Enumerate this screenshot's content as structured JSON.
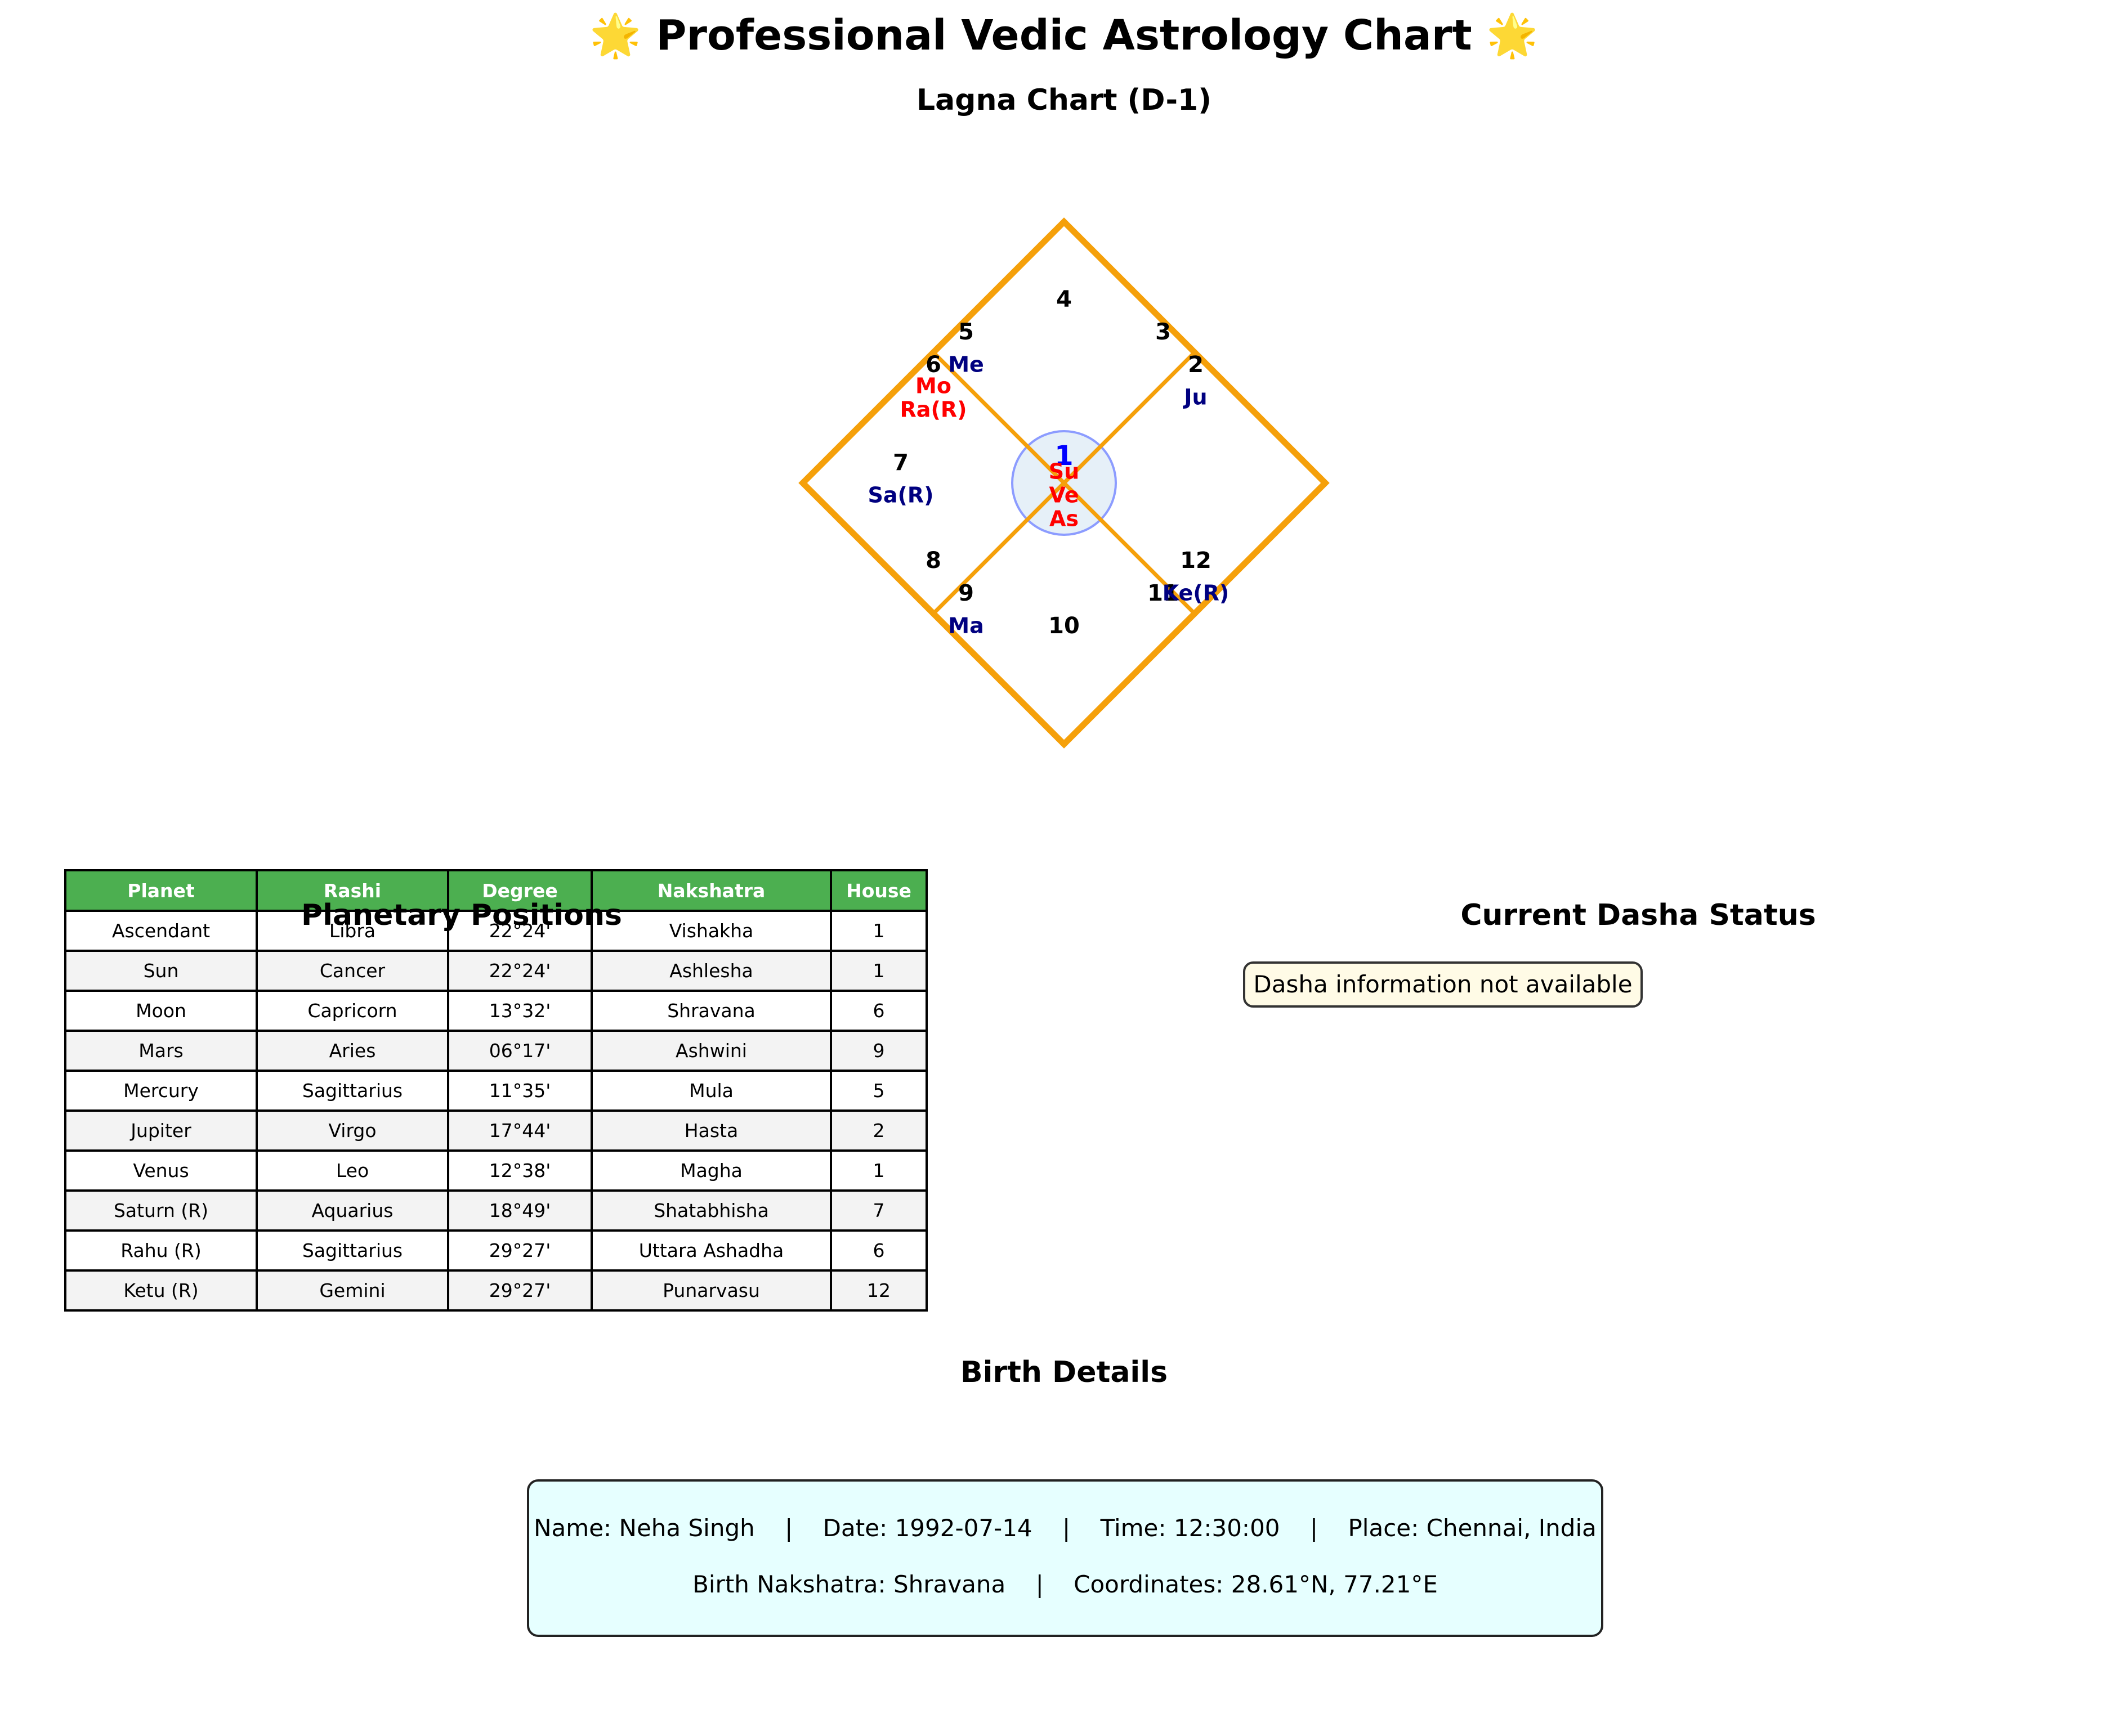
{
  "title": "🌟 Professional Vedic Astrology Chart 🌟",
  "chart_title": "Lagna Chart (D-1)",
  "colors": {
    "frame": "#f5a00a",
    "table_header": "#4caf50",
    "planet_benefic": "#000080",
    "planet_malefic": "#ff0000",
    "center_circle_fill": "#e6f0f8",
    "center_circle_stroke": "#8c9cff",
    "center_number": "#0000ff"
  },
  "houses": [
    {
      "number": "1",
      "planets": [
        "Su",
        "Ve",
        "As"
      ],
      "planet_color": "red"
    },
    {
      "number": "2",
      "planets": [
        "Ju"
      ],
      "planet_color": "navy"
    },
    {
      "number": "3",
      "planets": [],
      "planet_color": "navy"
    },
    {
      "number": "4",
      "planets": [],
      "planet_color": "navy"
    },
    {
      "number": "5",
      "planets": [
        "Me"
      ],
      "planet_color": "navy"
    },
    {
      "number": "6",
      "planets": [
        "Mo",
        "Ra(R)"
      ],
      "planet_color": "red"
    },
    {
      "number": "7",
      "planets": [
        "Sa(R)"
      ],
      "planet_color": "navy"
    },
    {
      "number": "8",
      "planets": [],
      "planet_color": "navy"
    },
    {
      "number": "9",
      "planets": [
        "Ma"
      ],
      "planet_color": "navy"
    },
    {
      "number": "10",
      "planets": [],
      "planet_color": "navy"
    },
    {
      "number": "11",
      "planets": [],
      "planet_color": "navy"
    },
    {
      "number": "12",
      "planets": [
        "Ke(R)"
      ],
      "planet_color": "navy"
    }
  ],
  "planetary_positions": {
    "title": "Planetary Positions",
    "columns": [
      "Planet",
      "Rashi",
      "Degree",
      "Nakshatra",
      "House"
    ],
    "rows": [
      [
        "Ascendant",
        "Libra",
        "22°24'",
        "Vishakha",
        "1"
      ],
      [
        "Sun",
        "Cancer",
        "22°24'",
        "Ashlesha",
        "1"
      ],
      [
        "Moon",
        "Capricorn",
        "13°32'",
        "Shravana",
        "6"
      ],
      [
        "Mars",
        "Aries",
        "06°17'",
        "Ashwini",
        "9"
      ],
      [
        "Mercury",
        "Sagittarius",
        "11°35'",
        "Mula",
        "5"
      ],
      [
        "Jupiter",
        "Virgo",
        "17°44'",
        "Hasta",
        "2"
      ],
      [
        "Venus",
        "Leo",
        "12°38'",
        "Magha",
        "1"
      ],
      [
        "Saturn (R)",
        "Aquarius",
        "18°49'",
        "Shatabhisha",
        "7"
      ],
      [
        "Rahu (R)",
        "Sagittarius",
        "29°27'",
        "Uttara Ashadha",
        "6"
      ],
      [
        "Ketu (R)",
        "Gemini",
        "29°27'",
        "Punarvasu",
        "12"
      ]
    ]
  },
  "dasha": {
    "title": "Current Dasha Status",
    "message": "Dasha information not available"
  },
  "birth_details": {
    "title": "Birth Details",
    "line1": "Name: Neha Singh    |    Date: 1992-07-14    |    Time: 12:30:00    |    Place: Chennai, India",
    "line2": "Birth Nakshatra: Shravana    |    Coordinates: 28.61°N, 77.21°E"
  }
}
